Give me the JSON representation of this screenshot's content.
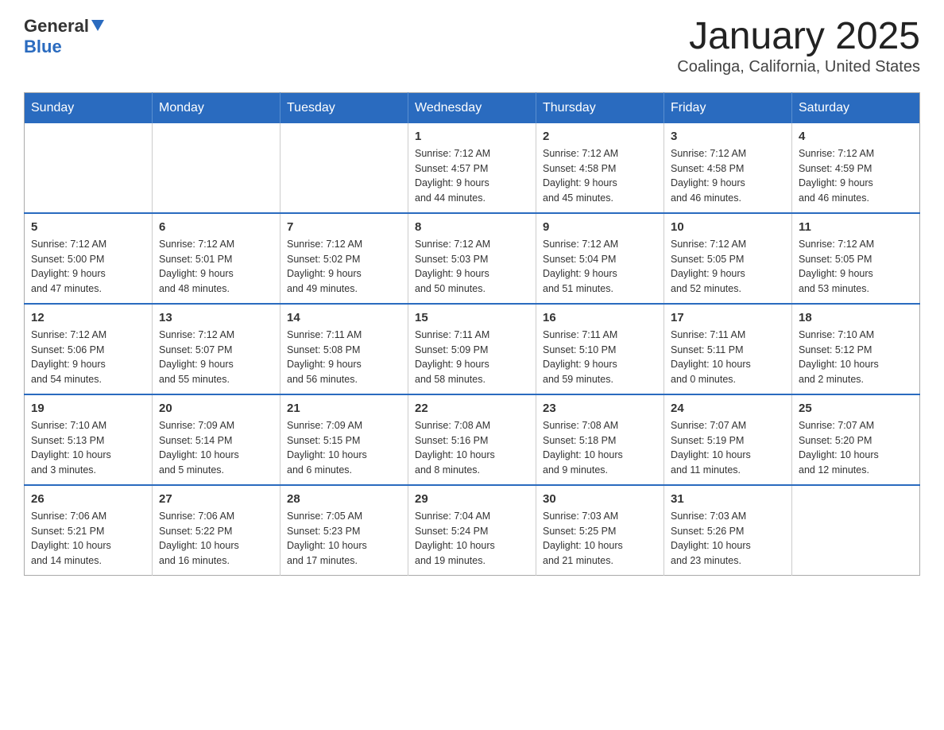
{
  "header": {
    "logo": {
      "general": "General",
      "blue": "Blue"
    },
    "title": "January 2025",
    "subtitle": "Coalinga, California, United States"
  },
  "calendar": {
    "headers": [
      "Sunday",
      "Monday",
      "Tuesday",
      "Wednesday",
      "Thursday",
      "Friday",
      "Saturday"
    ],
    "weeks": [
      [
        {
          "day": "",
          "info": ""
        },
        {
          "day": "",
          "info": ""
        },
        {
          "day": "",
          "info": ""
        },
        {
          "day": "1",
          "info": "Sunrise: 7:12 AM\nSunset: 4:57 PM\nDaylight: 9 hours\nand 44 minutes."
        },
        {
          "day": "2",
          "info": "Sunrise: 7:12 AM\nSunset: 4:58 PM\nDaylight: 9 hours\nand 45 minutes."
        },
        {
          "day": "3",
          "info": "Sunrise: 7:12 AM\nSunset: 4:58 PM\nDaylight: 9 hours\nand 46 minutes."
        },
        {
          "day": "4",
          "info": "Sunrise: 7:12 AM\nSunset: 4:59 PM\nDaylight: 9 hours\nand 46 minutes."
        }
      ],
      [
        {
          "day": "5",
          "info": "Sunrise: 7:12 AM\nSunset: 5:00 PM\nDaylight: 9 hours\nand 47 minutes."
        },
        {
          "day": "6",
          "info": "Sunrise: 7:12 AM\nSunset: 5:01 PM\nDaylight: 9 hours\nand 48 minutes."
        },
        {
          "day": "7",
          "info": "Sunrise: 7:12 AM\nSunset: 5:02 PM\nDaylight: 9 hours\nand 49 minutes."
        },
        {
          "day": "8",
          "info": "Sunrise: 7:12 AM\nSunset: 5:03 PM\nDaylight: 9 hours\nand 50 minutes."
        },
        {
          "day": "9",
          "info": "Sunrise: 7:12 AM\nSunset: 5:04 PM\nDaylight: 9 hours\nand 51 minutes."
        },
        {
          "day": "10",
          "info": "Sunrise: 7:12 AM\nSunset: 5:05 PM\nDaylight: 9 hours\nand 52 minutes."
        },
        {
          "day": "11",
          "info": "Sunrise: 7:12 AM\nSunset: 5:05 PM\nDaylight: 9 hours\nand 53 minutes."
        }
      ],
      [
        {
          "day": "12",
          "info": "Sunrise: 7:12 AM\nSunset: 5:06 PM\nDaylight: 9 hours\nand 54 minutes."
        },
        {
          "day": "13",
          "info": "Sunrise: 7:12 AM\nSunset: 5:07 PM\nDaylight: 9 hours\nand 55 minutes."
        },
        {
          "day": "14",
          "info": "Sunrise: 7:11 AM\nSunset: 5:08 PM\nDaylight: 9 hours\nand 56 minutes."
        },
        {
          "day": "15",
          "info": "Sunrise: 7:11 AM\nSunset: 5:09 PM\nDaylight: 9 hours\nand 58 minutes."
        },
        {
          "day": "16",
          "info": "Sunrise: 7:11 AM\nSunset: 5:10 PM\nDaylight: 9 hours\nand 59 minutes."
        },
        {
          "day": "17",
          "info": "Sunrise: 7:11 AM\nSunset: 5:11 PM\nDaylight: 10 hours\nand 0 minutes."
        },
        {
          "day": "18",
          "info": "Sunrise: 7:10 AM\nSunset: 5:12 PM\nDaylight: 10 hours\nand 2 minutes."
        }
      ],
      [
        {
          "day": "19",
          "info": "Sunrise: 7:10 AM\nSunset: 5:13 PM\nDaylight: 10 hours\nand 3 minutes."
        },
        {
          "day": "20",
          "info": "Sunrise: 7:09 AM\nSunset: 5:14 PM\nDaylight: 10 hours\nand 5 minutes."
        },
        {
          "day": "21",
          "info": "Sunrise: 7:09 AM\nSunset: 5:15 PM\nDaylight: 10 hours\nand 6 minutes."
        },
        {
          "day": "22",
          "info": "Sunrise: 7:08 AM\nSunset: 5:16 PM\nDaylight: 10 hours\nand 8 minutes."
        },
        {
          "day": "23",
          "info": "Sunrise: 7:08 AM\nSunset: 5:18 PM\nDaylight: 10 hours\nand 9 minutes."
        },
        {
          "day": "24",
          "info": "Sunrise: 7:07 AM\nSunset: 5:19 PM\nDaylight: 10 hours\nand 11 minutes."
        },
        {
          "day": "25",
          "info": "Sunrise: 7:07 AM\nSunset: 5:20 PM\nDaylight: 10 hours\nand 12 minutes."
        }
      ],
      [
        {
          "day": "26",
          "info": "Sunrise: 7:06 AM\nSunset: 5:21 PM\nDaylight: 10 hours\nand 14 minutes."
        },
        {
          "day": "27",
          "info": "Sunrise: 7:06 AM\nSunset: 5:22 PM\nDaylight: 10 hours\nand 16 minutes."
        },
        {
          "day": "28",
          "info": "Sunrise: 7:05 AM\nSunset: 5:23 PM\nDaylight: 10 hours\nand 17 minutes."
        },
        {
          "day": "29",
          "info": "Sunrise: 7:04 AM\nSunset: 5:24 PM\nDaylight: 10 hours\nand 19 minutes."
        },
        {
          "day": "30",
          "info": "Sunrise: 7:03 AM\nSunset: 5:25 PM\nDaylight: 10 hours\nand 21 minutes."
        },
        {
          "day": "31",
          "info": "Sunrise: 7:03 AM\nSunset: 5:26 PM\nDaylight: 10 hours\nand 23 minutes."
        },
        {
          "day": "",
          "info": ""
        }
      ]
    ]
  }
}
